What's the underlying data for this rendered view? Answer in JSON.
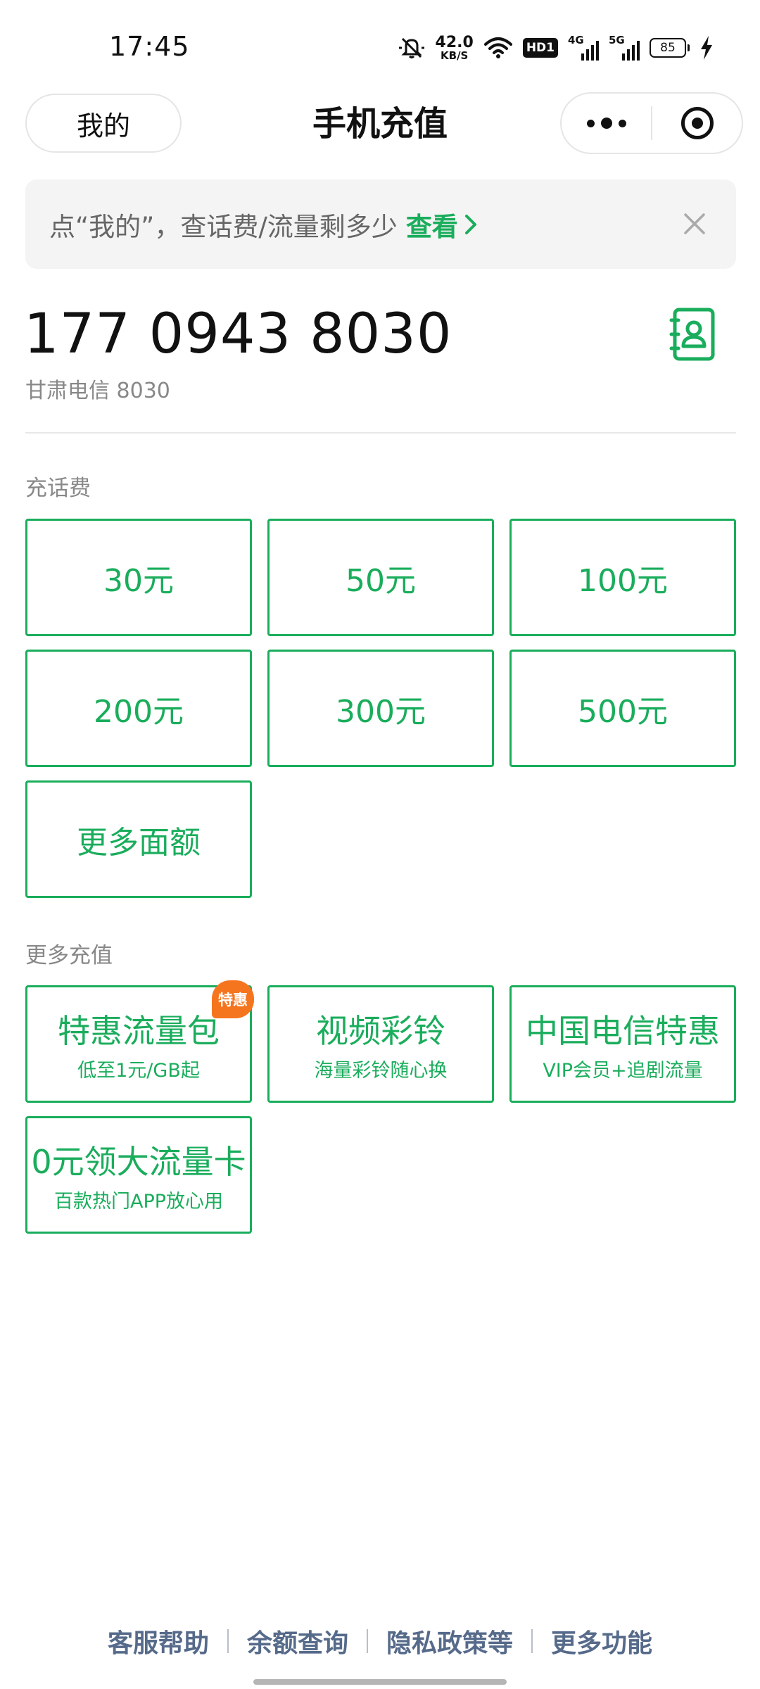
{
  "status_bar": {
    "time": "17:45",
    "speed_value": "42.0",
    "speed_unit": "KB/S",
    "hd_label": "HD1",
    "net1_label": "4G",
    "net2_label": "5G",
    "battery_level": "85",
    "icons": [
      "mute-icon",
      "wifi-icon",
      "hd-icon",
      "signal-4g-icon",
      "signal-5g-icon",
      "battery-icon",
      "charging-icon"
    ]
  },
  "nav": {
    "mine_label": "我的",
    "title": "手机充值",
    "more_icon": "more-dots-icon",
    "close_icon": "target-icon"
  },
  "notice": {
    "text": "点“我的”，查话费/流量剩多少",
    "link_label": "查看",
    "close_icon": "close-icon"
  },
  "phone": {
    "number": "177 0943 8030",
    "carrier": "甘肃电信 8030",
    "contacts_icon": "contacts-icon"
  },
  "recharge": {
    "section_label": "充话费",
    "options": [
      "30元",
      "50元",
      "100元",
      "200元",
      "300元",
      "500元",
      "更多面额"
    ]
  },
  "more": {
    "section_label": "更多充值",
    "items": [
      {
        "title": "特惠流量包",
        "subtitle": "低至1元/GB起",
        "badge": "特惠"
      },
      {
        "title": "视频彩铃",
        "subtitle": "海量彩铃随心换"
      },
      {
        "title": "中国电信特惠",
        "subtitle": "VIP会员+追剧流量"
      },
      {
        "title": "0元领大流量卡",
        "subtitle": "百款热门APP放心用"
      }
    ]
  },
  "footer": {
    "links": [
      "客服帮助",
      "余额查询",
      "隐私政策等",
      "更多功能"
    ]
  },
  "colors": {
    "accent": "#1aad5c",
    "badge": "#f5751f",
    "footer_link": "#566a8a"
  }
}
